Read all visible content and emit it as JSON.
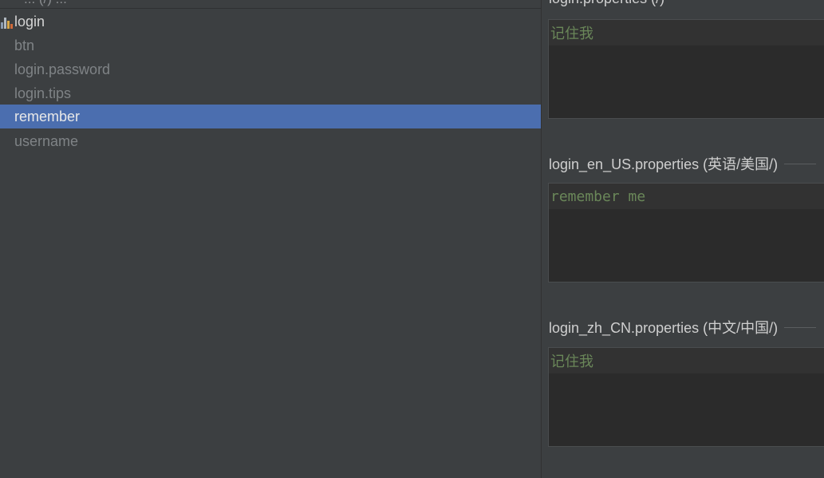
{
  "tree": {
    "clipped_header": "... (/) ...",
    "root": {
      "label": "login",
      "icon": "resource-bundle-icon"
    },
    "items": [
      {
        "label": "btn",
        "selected": false
      },
      {
        "label": "login.password",
        "selected": false
      },
      {
        "label": "login.tips",
        "selected": false
      },
      {
        "label": "remember",
        "selected": true
      },
      {
        "label": "username",
        "selected": false
      }
    ]
  },
  "editor": {
    "sections": [
      {
        "title": "login.properties (/)",
        "value": "记住我"
      },
      {
        "title": "login_en_US.properties (英语/美国/)",
        "value": "remember me"
      },
      {
        "title": "login_zh_CN.properties (中文/中国/)",
        "value": "记住我"
      }
    ]
  },
  "colors": {
    "background": "#3c3f41",
    "selection": "#4b6eaf",
    "editor_background": "#2b2b2b",
    "string_value": "#6a8759",
    "inactive_text": "#7f8386"
  }
}
